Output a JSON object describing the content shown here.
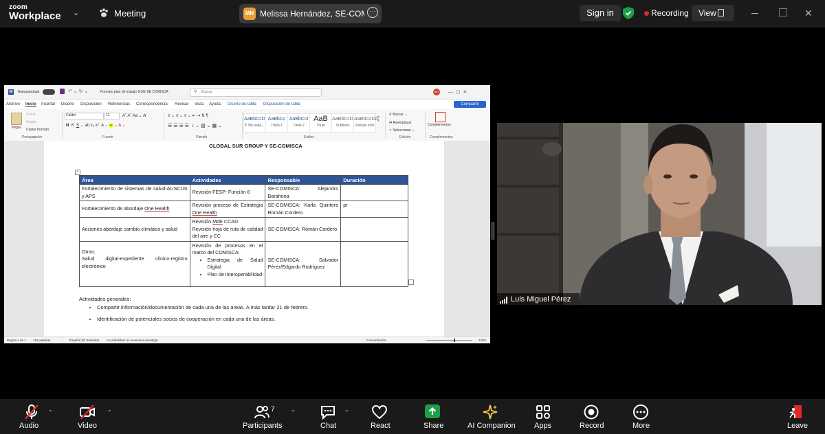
{
  "topbar": {
    "logo_small": "zoom",
    "logo_main": "Workplace",
    "meeting_label": "Meeting",
    "host_initials": "MH",
    "host_name": "Melissa Hernández, SE-COMISCA",
    "sign_in": "Sign in",
    "recording": "Recording",
    "view": "View"
  },
  "document": {
    "autosave_label": "Autoguardado",
    "file_name": "Formato plan de trabajo GSG-SE COMISCA",
    "search_placeholder": "Buscar",
    "user_initials": "MH",
    "tabs": [
      "Archivo",
      "Inicio",
      "Insertar",
      "Diseño",
      "Disposición",
      "Referencias",
      "Correspondencia",
      "Revisar",
      "Vista",
      "Ayuda",
      "Diseño de tabla",
      "Disposición de tabla"
    ],
    "share_label": "Compartir",
    "ribbon": {
      "paste": "Pegar",
      "cut": "Cortar",
      "copy": "Copiar",
      "format_painter": "Copiar formato",
      "font_name": "Calibri",
      "font_size": "12",
      "styles": [
        {
          "sample": "AaBbCcDd",
          "name": "¶ Sin espa..."
        },
        {
          "sample": "AaBbCc",
          "name": "Título 1"
        },
        {
          "sample": "AaBbCcI",
          "name": "Título 2"
        },
        {
          "sample": "AaB",
          "name": "Título"
        },
        {
          "sample": "AaBbCcD",
          "name": "Subtítulo"
        },
        {
          "sample": "AaBbCcDd",
          "name": "Énfasis sutil"
        }
      ],
      "find": "Buscar",
      "replace": "Reemplazar",
      "select": "Seleccionar",
      "addins": "Complementos",
      "groups": [
        "Portapapeles",
        "Fuente",
        "Párrafo",
        "Estilos",
        "Edición",
        "Complementos"
      ]
    },
    "heading": "GLOBAL SUR GROUP Y SE-COMISCA",
    "table": {
      "headers": [
        "Área",
        "Actividades",
        "Responsable",
        "Duración"
      ],
      "rows": [
        {
          "area": "Fortalecimiento de sistemas de salud-AUSCUS y APS",
          "activity": "Revisión FESP: Función 6",
          "responsible": "SE-COMISCA: Alejandro Barahona",
          "duration": ""
        },
        {
          "area_pre": "Fortalecimiento de abordaje ",
          "area_u": "One Health",
          "activity_pre": "Revisión proceso de Estrategia ",
          "activity_u": "One Health",
          "responsible": "SE-COMISCA: Karla Quintero Román Cordero",
          "duration": "pr"
        },
        {
          "area": "Acciones abordaje cambio climático y salud",
          "activity_line1_pre": "Revisión ",
          "activity_line1_u": "MdE",
          "activity_line1_post": " CCAD",
          "activity_line2": "Revisión hoja de ruta de calidad del aire y CC",
          "responsible": "SE-COMISCA: Román Cordero",
          "duration": ""
        },
        {
          "area_line1": "Otras:",
          "area_line2": "Salud digital-expediente clínico-registro electrónico",
          "activity_intro": "Revisión de procesos en el marco del COMISCA:",
          "activity_items": [
            "Estrategia de Salud Digital",
            "Plan de interoperabilidad"
          ],
          "responsible": "SE-COMISCA: Salvador Pérez/Edgardo Rodríguez",
          "duration": ""
        }
      ]
    },
    "general_title": "Actividades generales:",
    "general_items": [
      "Compartir información/documentación de cada una de las áreas. A más tardar 21 de febrero.",
      "Identificación de potenciales socios de cooperación en cada una de las áreas."
    ],
    "status": {
      "page": "Página 1 de 1",
      "words": "119 palabras",
      "language": "Español (El Salvador)",
      "accessibility": "Accesibilidad: es necesario investigar",
      "focus": "Concentración",
      "zoom": "120%"
    }
  },
  "participant": {
    "name": "Luis Miguel Pérez"
  },
  "toolbar": {
    "audio": "Audio",
    "video": "Video",
    "participants": "Participants",
    "participants_count": "7",
    "chat": "Chat",
    "react": "React",
    "share": "Share",
    "ai_companion": "AI Companion",
    "apps": "Apps",
    "record": "Record",
    "more": "More",
    "leave": "Leave"
  },
  "colors": {
    "accent_green": "#1e9e4a",
    "recording_red": "#e02828",
    "leave_red": "#e02828",
    "table_header": "#2f5496",
    "ai_gold": "#f2c94c"
  }
}
